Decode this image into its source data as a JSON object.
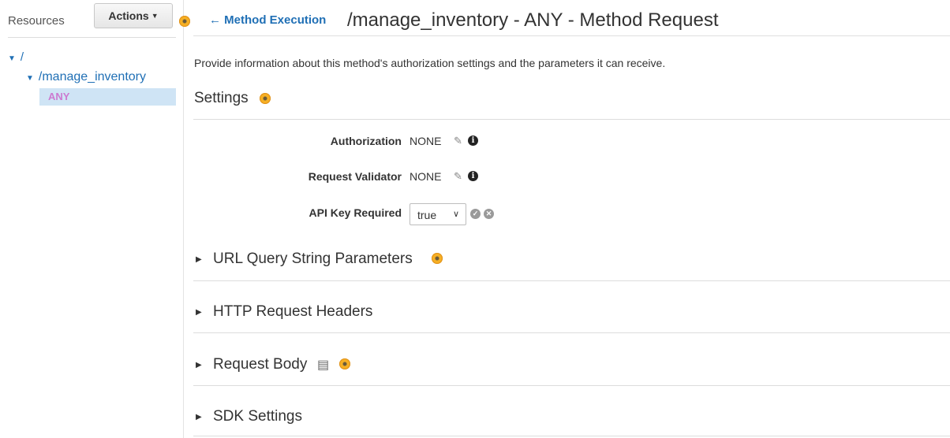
{
  "sidebar": {
    "resources_label": "Resources",
    "actions_label": "Actions",
    "tree": {
      "root": "/",
      "child": "/manage_inventory",
      "method": "ANY"
    }
  },
  "header": {
    "back_label": "Method Execution",
    "title": "/manage_inventory - ANY - Method Request"
  },
  "description": "Provide information about this method's authorization settings and the parameters it can receive.",
  "settings": {
    "title": "Settings",
    "authorization": {
      "label": "Authorization",
      "value": "NONE"
    },
    "request_validator": {
      "label": "Request Validator",
      "value": "NONE"
    },
    "api_key": {
      "label": "API Key Required",
      "value": "true"
    }
  },
  "sections": [
    {
      "label": "URL Query String Parameters"
    },
    {
      "label": "HTTP Request Headers"
    },
    {
      "label": "Request Body"
    },
    {
      "label": "SDK Settings"
    }
  ],
  "colors": {
    "link": "#1f6fb5",
    "method": "#cc7ad0",
    "selected_bg": "#cfe4f5",
    "help_dot": "#f5a623"
  }
}
